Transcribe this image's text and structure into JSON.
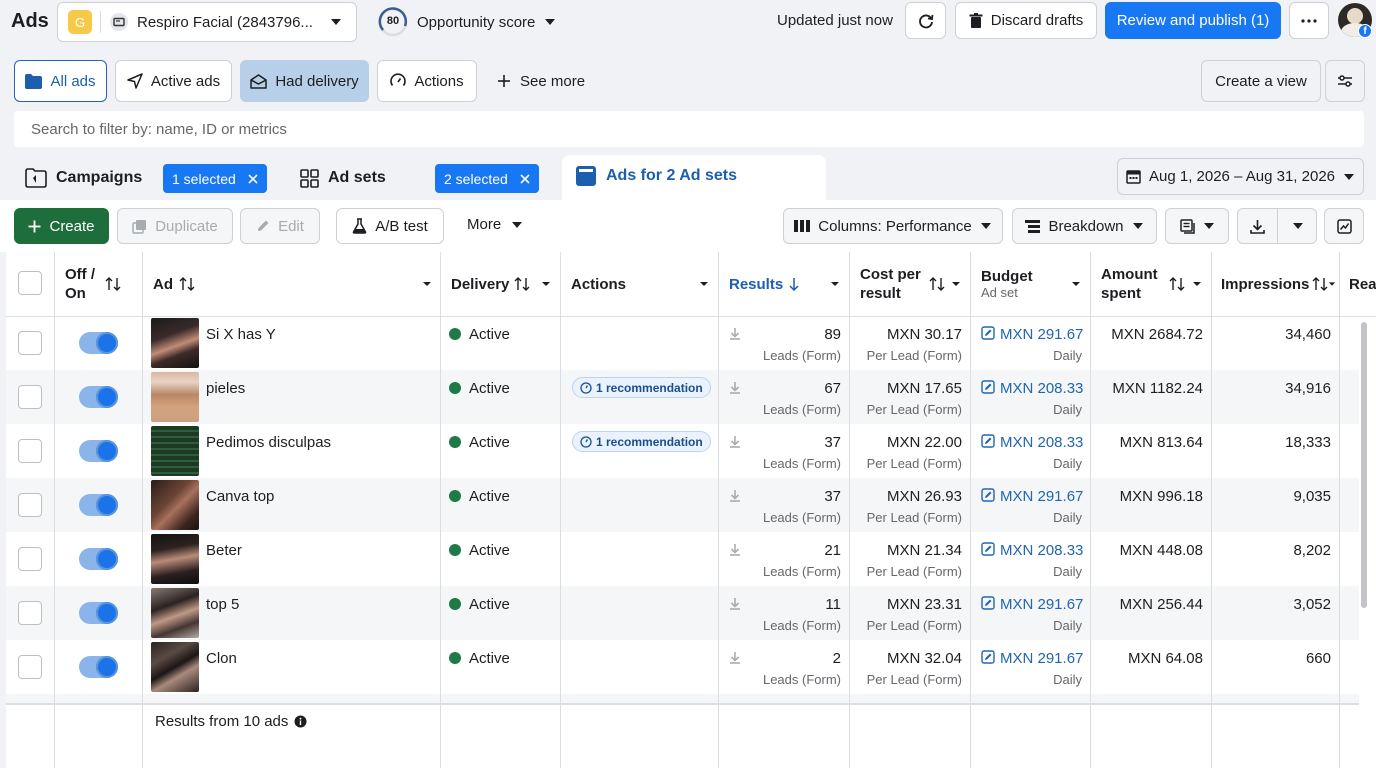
{
  "topbar": {
    "app_title": "Ads",
    "account_initial": "G",
    "account_name": "Respiro Facial (2843796...",
    "opportunity_score": "80",
    "opportunity_label": "Opportunity score",
    "updated_text": "Updated just now",
    "discard_label": "Discard drafts",
    "review_label": "Review and publish (1)"
  },
  "filters": {
    "all_ads": "All ads",
    "active_ads": "Active ads",
    "had_delivery": "Had delivery",
    "actions": "Actions",
    "see_more": "See more",
    "create_view": "Create a view"
  },
  "search": {
    "placeholder": "Search to filter by: name, ID or metrics"
  },
  "level_tabs": {
    "campaigns_label": "Campaigns",
    "campaigns_selected": "1 selected",
    "adsets_label": "Ad sets",
    "adsets_selected": "2 selected",
    "ads_label": "Ads for 2 Ad sets"
  },
  "date_range": "Aug 1, 2026 – Aug 31, 2026",
  "toolbar": {
    "create": "Create",
    "duplicate": "Duplicate",
    "edit": "Edit",
    "ab_test": "A/B test",
    "more": "More",
    "columns": "Columns: Performance",
    "breakdown": "Breakdown"
  },
  "table": {
    "headers": {
      "off_on": "Off / On",
      "ad": "Ad",
      "delivery": "Delivery",
      "actions": "Actions",
      "results": "Results",
      "cost_per_result": "Cost per result",
      "budget": "Budget",
      "budget_sub": "Ad set",
      "amount_spent": "Amount spent",
      "impressions": "Impressions",
      "reach_partial": "Rea"
    },
    "rows": [
      {
        "name": "Si X has Y",
        "delivery": "Active",
        "recommendation": "",
        "results": "89",
        "results_type": "Leads (Form)",
        "cost": "MXN 30.17",
        "cost_type": "Per Lead (Form)",
        "budget": "MXN 291.67",
        "budget_type": "Daily",
        "spent": "MXN 2684.72",
        "impressions": "34,460"
      },
      {
        "name": "pieles",
        "delivery": "Active",
        "recommendation": "1 recommendation",
        "results": "67",
        "results_type": "Leads (Form)",
        "cost": "MXN 17.65",
        "cost_type": "Per Lead (Form)",
        "budget": "MXN 208.33",
        "budget_type": "Daily",
        "spent": "MXN 1182.24",
        "impressions": "34,916"
      },
      {
        "name": "Pedimos disculpas",
        "delivery": "Active",
        "recommendation": "1 recommendation",
        "results": "37",
        "results_type": "Leads (Form)",
        "cost": "MXN 22.00",
        "cost_type": "Per Lead (Form)",
        "budget": "MXN 208.33",
        "budget_type": "Daily",
        "spent": "MXN 813.64",
        "impressions": "18,333"
      },
      {
        "name": "Canva top",
        "delivery": "Active",
        "recommendation": "",
        "results": "37",
        "results_type": "Leads (Form)",
        "cost": "MXN 26.93",
        "cost_type": "Per Lead (Form)",
        "budget": "MXN 291.67",
        "budget_type": "Daily",
        "spent": "MXN 996.18",
        "impressions": "9,035"
      },
      {
        "name": "Beter",
        "delivery": "Active",
        "recommendation": "",
        "results": "21",
        "results_type": "Leads (Form)",
        "cost": "MXN 21.34",
        "cost_type": "Per Lead (Form)",
        "budget": "MXN 208.33",
        "budget_type": "Daily",
        "spent": "MXN 448.08",
        "impressions": "8,202"
      },
      {
        "name": "top 5",
        "delivery": "Active",
        "recommendation": "",
        "results": "11",
        "results_type": "Leads (Form)",
        "cost": "MXN 23.31",
        "cost_type": "Per Lead (Form)",
        "budget": "MXN 291.67",
        "budget_type": "Daily",
        "spent": "MXN 256.44",
        "impressions": "3,052"
      },
      {
        "name": "Clon",
        "delivery": "Active",
        "recommendation": "",
        "results": "2",
        "results_type": "Leads (Form)",
        "cost": "MXN 32.04",
        "cost_type": "Per Lead (Form)",
        "budget": "MXN 291.67",
        "budget_type": "Daily",
        "spent": "MXN 64.08",
        "impressions": "660"
      }
    ],
    "footer": "Results from 10 ads"
  },
  "colors": {
    "primary": "#1877f2",
    "create_green": "#1e6e3c",
    "active_dot": "#1e7a46",
    "link": "#2066b0"
  }
}
